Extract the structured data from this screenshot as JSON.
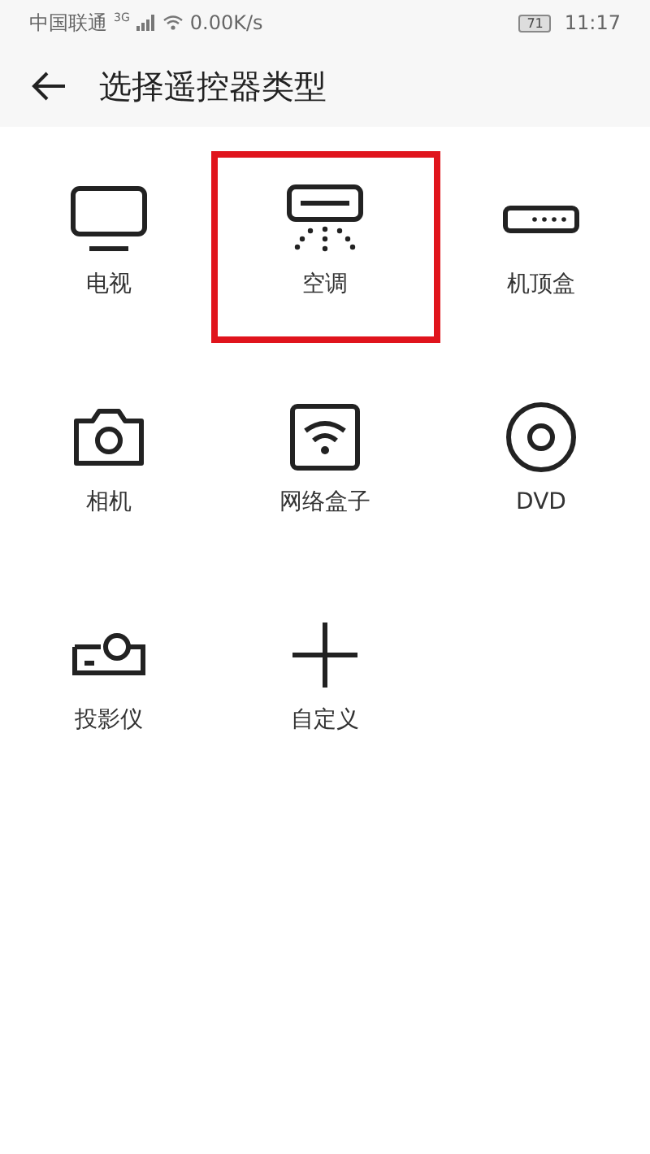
{
  "status_bar": {
    "carrier": "中国联通",
    "network": "3G",
    "speed": "0.00K/s",
    "battery": "71",
    "time": "11:17"
  },
  "header": {
    "title": "选择遥控器类型"
  },
  "devices": [
    {
      "kind": "tv",
      "label": "电视",
      "highlighted": false
    },
    {
      "kind": "ac",
      "label": "空调",
      "highlighted": true
    },
    {
      "kind": "stb",
      "label": "机顶盒",
      "highlighted": false
    },
    {
      "kind": "camera",
      "label": "相机",
      "highlighted": false
    },
    {
      "kind": "netbox",
      "label": "网络盒子",
      "highlighted": false
    },
    {
      "kind": "dvd",
      "label": "DVD",
      "highlighted": false
    },
    {
      "kind": "projector",
      "label": "投影仪",
      "highlighted": false
    },
    {
      "kind": "custom",
      "label": "自定义",
      "highlighted": false
    }
  ]
}
